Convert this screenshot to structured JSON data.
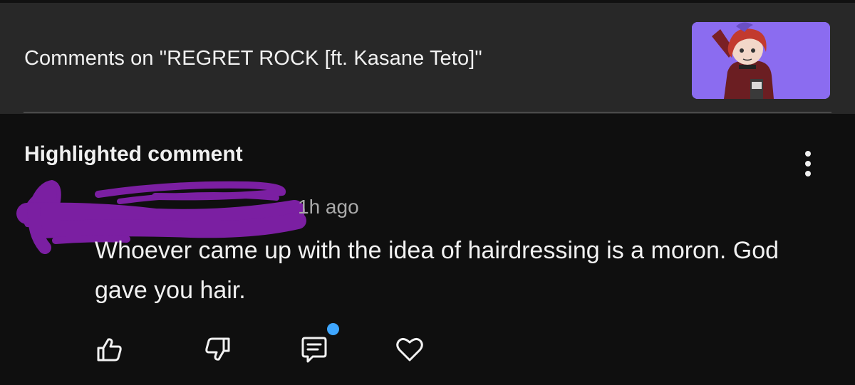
{
  "header": {
    "title": "Comments on \"REGRET ROCK [ft. Kasane Teto]\"",
    "thumbnail_background": "#8b6cf0",
    "thumbnail_icon": "video-thumbnail-icon"
  },
  "comment": {
    "section_label": "Highlighted comment",
    "author_redacted": true,
    "redaction_color": "#7b1fa2",
    "timestamp": "1h ago",
    "text": "Whoever came up with the idea of hairdressing is a moron. God gave you hair."
  },
  "actions": {
    "like_icon": "thumbs-up-icon",
    "dislike_icon": "thumbs-down-icon",
    "reply_icon": "reply-comment-icon",
    "heart_icon": "heart-icon",
    "notification_dot_color": "#3ea6ff"
  },
  "colors": {
    "background": "#0f0f0f",
    "header_background": "#282828",
    "text": "#f1f1f1",
    "secondary_text": "#aaaaaa"
  }
}
